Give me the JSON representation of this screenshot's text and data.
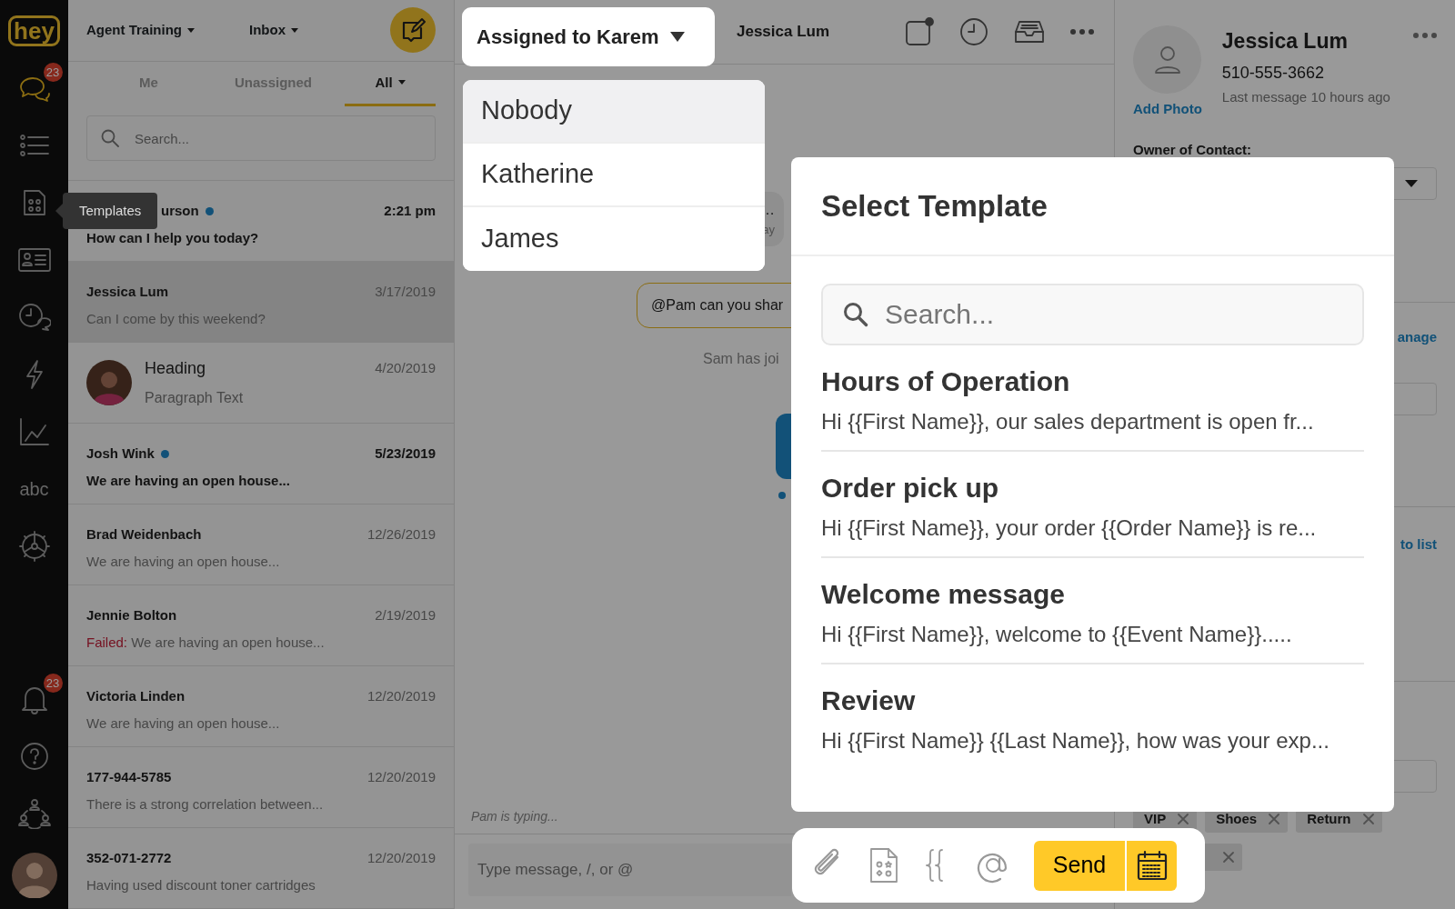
{
  "rail": {
    "logo": "hey",
    "chat_badge": "23",
    "text_item": "abc",
    "bell_badge": "23"
  },
  "tooltip": "Templates",
  "list_header": {
    "workspace": "Agent Training",
    "inbox": "Inbox"
  },
  "tabs": [
    {
      "label": "Me",
      "selected": false
    },
    {
      "label": "Unassigned",
      "selected": false
    },
    {
      "label": "All",
      "selected": true
    }
  ],
  "search": {
    "placeholder": "Search..."
  },
  "conversations": [
    {
      "name": "urson",
      "time": "2:21 pm",
      "message": "How can I help you today?",
      "unread": true,
      "online": true,
      "selected": false,
      "avatar": false
    },
    {
      "name": "Jessica Lum",
      "time": "3/17/2019",
      "message": "Can I come by this weekend?",
      "unread": false,
      "online": false,
      "selected": true,
      "avatar": false
    },
    {
      "name": "Heading",
      "time": "4/20/2019",
      "message": "Paragraph Text",
      "unread": false,
      "online": false,
      "selected": false,
      "avatar": true
    },
    {
      "name": "Josh Wink",
      "time": "5/23/2019",
      "message": "We are having an open house...",
      "unread": true,
      "online": true,
      "selected": false,
      "avatar": false
    },
    {
      "name": "Brad Weidenbach",
      "time": "12/26/2019",
      "message": "We are having an open house...",
      "unread": false,
      "online": false,
      "selected": false,
      "avatar": false
    },
    {
      "name": "Jennie Bolton",
      "time": "2/19/2019",
      "status": "Failed:",
      "message": "We are having an open house...",
      "unread": false,
      "online": false,
      "selected": false,
      "avatar": false
    },
    {
      "name": "Victoria Linden",
      "time": "12/20/2019",
      "message": "We are having an open house...",
      "unread": false,
      "online": false,
      "selected": false,
      "avatar": false
    },
    {
      "name": "177-944-5785",
      "time": "12/20/2019",
      "message": "There is a strong correlation between...",
      "unread": false,
      "online": false,
      "selected": false,
      "avatar": false
    },
    {
      "name": "352-071-2772",
      "time": "12/20/2019",
      "message": "Having used discount toner cartridges",
      "unread": false,
      "online": false,
      "selected": false,
      "avatar": false
    }
  ],
  "chat": {
    "assign": "Assigned to Karem",
    "contact": "Jessica Lum",
    "assign_menu": [
      {
        "label": "Nobody",
        "selected": true
      },
      {
        "label": "Katherine",
        "selected": false
      },
      {
        "label": "James",
        "selected": false
      }
    ],
    "messages": [
      {
        "kind": "incoming",
        "text": "…",
        "meta": "ay"
      },
      {
        "kind": "note",
        "text": "@Pam can you shar"
      },
      {
        "kind": "event",
        "text": "Sam has joi"
      },
      {
        "kind": "outgoing"
      }
    ],
    "typing": "Pam is typing...",
    "composer": {
      "placeholder": "Type message, /, or @",
      "send": "Send"
    }
  },
  "template_modal": {
    "title": "Select Template",
    "search_placeholder": "Search...",
    "templates": [
      {
        "title": "Hours of Operation",
        "preview": "Hi {{First Name}}, our sales department is open fr..."
      },
      {
        "title": "Order pick up",
        "preview": "Hi {{First Name}}, your order {{Order Name}} is re..."
      },
      {
        "title": "Welcome message",
        "preview": "Hi {{First Name}}, welcome to {{Event Name}}....."
      },
      {
        "title": "Review",
        "preview": "Hi {{First Name}} {{Last Name}}, how was your exp..."
      }
    ]
  },
  "contact": {
    "add_photo": "Add Photo",
    "name": "Jessica Lum",
    "phone": "510-555-3662",
    "last_message": "Last message 10 hours ago",
    "owner_label": "Owner of Contact:",
    "manage_link": "anage",
    "list_link": "to list",
    "tags": [
      {
        "label": "VIP"
      },
      {
        "label": "Shoes"
      },
      {
        "label": "Return"
      }
    ]
  }
}
